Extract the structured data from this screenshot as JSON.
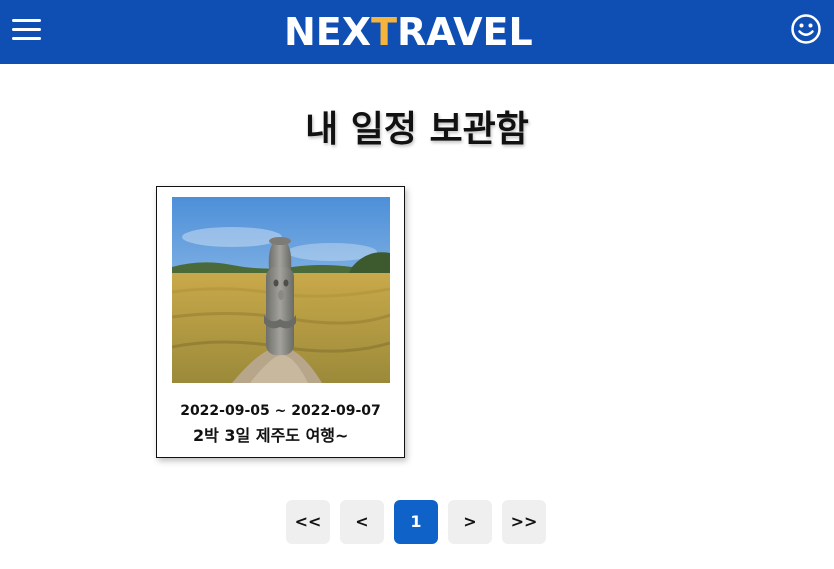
{
  "header": {
    "logo_main": "NEX",
    "logo_accent": "T",
    "logo_rest": "RAVEL",
    "menu_icon": "hamburger-menu-icon",
    "profile_icon": "smiley-icon",
    "background_color": "#0f4fb4",
    "accent_color": "#f5b43c"
  },
  "page": {
    "title": "내 일정 보관함"
  },
  "trips": [
    {
      "dates": "2022-09-05 ~ 2022-09-07",
      "title": "2박 3일 제주도 여행~",
      "image": "dol-hareubang-in-field-photo"
    }
  ],
  "pagination": {
    "first": "<<",
    "prev": "<",
    "current": "1",
    "next": ">",
    "last": ">>",
    "active_color": "#0f63c8"
  }
}
